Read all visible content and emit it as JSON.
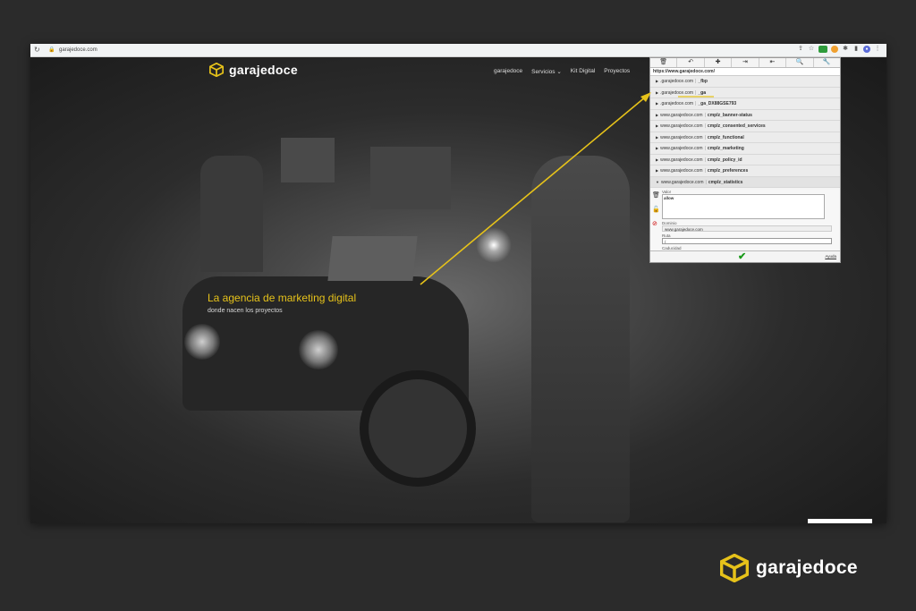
{
  "browser": {
    "url": "garajedoce.com"
  },
  "site": {
    "logo_text": "garajedoce",
    "nav": [
      "garajedoce",
      "Servicios ⌄",
      "Kit Digital",
      "Proyectos"
    ],
    "hero_title": "La agencia de marketing digital",
    "hero_subtitle": "donde nacen los proyectos"
  },
  "cookie_panel": {
    "toolbar_icons": [
      "trash-icon",
      "undo-icon",
      "plus-icon",
      "import-icon",
      "export-icon",
      "search-icon",
      "wrench-icon"
    ],
    "toolbar_glyphs": [
      "🗑",
      "↶",
      "✚",
      "⇥",
      "⇤",
      "🔍",
      "🔧"
    ],
    "current_url": "https://www.garajedoce.com/",
    "cookies": [
      {
        "domain": ".garajedoce.com",
        "name": "_fbp"
      },
      {
        "domain": ".garajedoce.com",
        "name": "_ga"
      },
      {
        "domain": ".garajedoce.com",
        "name": "_ga_DX88GSE793"
      },
      {
        "domain": "www.garajedoce.com",
        "name": "cmplz_banner-status"
      },
      {
        "domain": "www.garajedoce.com",
        "name": "cmplz_consented_services"
      },
      {
        "domain": "www.garajedoce.com",
        "name": "cmplz_functional"
      },
      {
        "domain": "www.garajedoce.com",
        "name": "cmplz_marketing"
      },
      {
        "domain": "www.garajedoce.com",
        "name": "cmplz_policy_id"
      },
      {
        "domain": "www.garajedoce.com",
        "name": "cmplz_preferences"
      },
      {
        "domain": "www.garajedoce.com",
        "name": "cmplz_statistics"
      }
    ],
    "detail": {
      "value_label": "Valor",
      "value": "allow",
      "domain_label": "Dominio",
      "domain": "www.garajedoce.com",
      "path_label": "Ruta",
      "path": "/",
      "expiry_label": "Caducidad"
    },
    "help_label": "Ayuda"
  },
  "brand": {
    "text": "garajedoce"
  },
  "colors": {
    "accent": "#e6c21a",
    "background": "#2b2b2b"
  }
}
